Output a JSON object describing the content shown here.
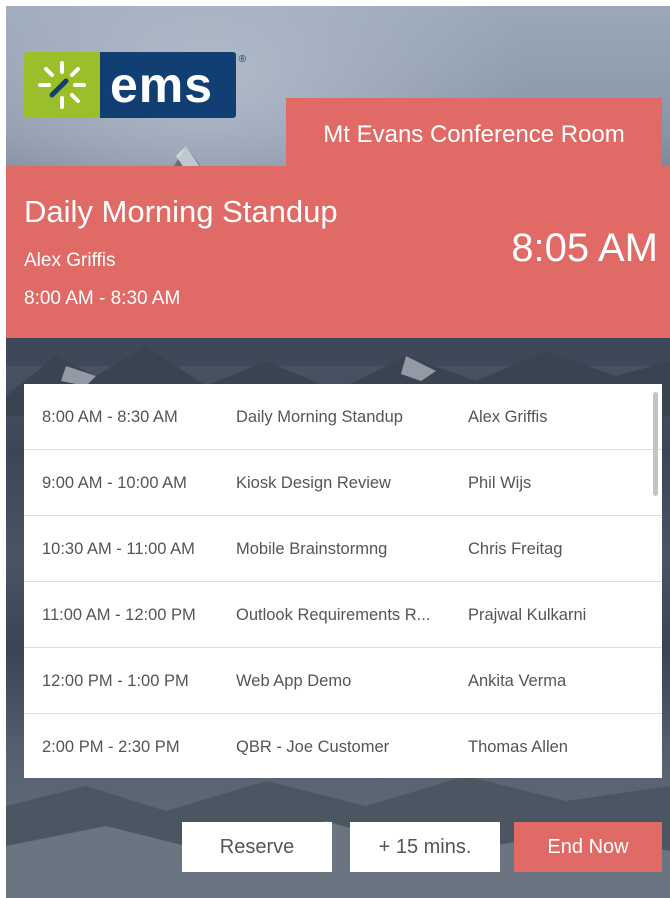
{
  "brand": {
    "logo_text": "ems",
    "registered_mark": "®",
    "mark_color": "#9bbf2a",
    "text_bg_color": "#123f73"
  },
  "room": {
    "name": "Mt Evans Conference Room"
  },
  "current_meeting": {
    "title": "Daily Morning Standup",
    "organizer": "Alex Griffis",
    "time_range": "8:00 AM - 8:30 AM",
    "current_time": "8:05 AM"
  },
  "schedule": [
    {
      "time": "8:00 AM - 8:30 AM",
      "title": "Daily Morning Standup",
      "organizer": "Alex Griffis"
    },
    {
      "time": "9:00 AM - 10:00 AM",
      "title": "Kiosk Design Review",
      "organizer": "Phil Wijs"
    },
    {
      "time": "10:30 AM - 11:00 AM",
      "title": "Mobile Brainstormng",
      "organizer": "Chris Freitag"
    },
    {
      "time": "11:00 AM - 12:00 PM",
      "title": "Outlook Requirements R...",
      "organizer": "Prajwal Kulkarni"
    },
    {
      "time": "12:00 PM - 1:00 PM",
      "title": "Web App Demo",
      "organizer": "Ankita Verma"
    },
    {
      "time": "2:00 PM - 2:30 PM",
      "title": "QBR - Joe Customer",
      "organizer": "Thomas Allen"
    }
  ],
  "actions": {
    "reserve_label": "Reserve",
    "extend_label": "+ 15 mins.",
    "end_label": "End Now"
  },
  "colors": {
    "accent": "#e06a66",
    "panel": "#ffffff"
  }
}
